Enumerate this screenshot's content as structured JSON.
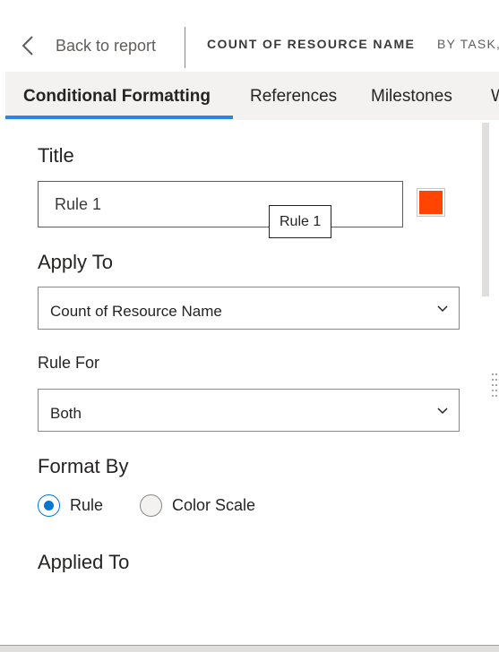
{
  "header": {
    "back_label": "Back to report",
    "breadcrumb_title": "COUNT OF RESOURCE NAME",
    "breadcrumb_sub": "BY TASK,"
  },
  "tabs": [
    {
      "label": "Conditional Formatting",
      "active": true
    },
    {
      "label": "References",
      "active": false
    },
    {
      "label": "Milestones",
      "active": false
    },
    {
      "label": "W",
      "active": false
    }
  ],
  "form": {
    "title_label": "Title",
    "title_value": "Rule 1",
    "title_color": "#ff4500",
    "tooltip": "Rule 1",
    "apply_to_label": "Apply To",
    "apply_to_value": "Count of Resource Name",
    "rule_for_label": "Rule For",
    "rule_for_value": "Both",
    "format_by_label": "Format By",
    "format_by_options": [
      {
        "label": "Rule",
        "selected": true
      },
      {
        "label": "Color Scale",
        "selected": false
      }
    ],
    "applied_to_label": "Applied To"
  },
  "icons": {
    "back": "chevron-left-icon",
    "dropdown": "chevron-down-icon",
    "drag": "drag-handle-icon"
  },
  "colors": {
    "accent": "#0078d4",
    "tab_underline": "#2b88d8",
    "tab_bar_bg": "#f3f2f1"
  }
}
